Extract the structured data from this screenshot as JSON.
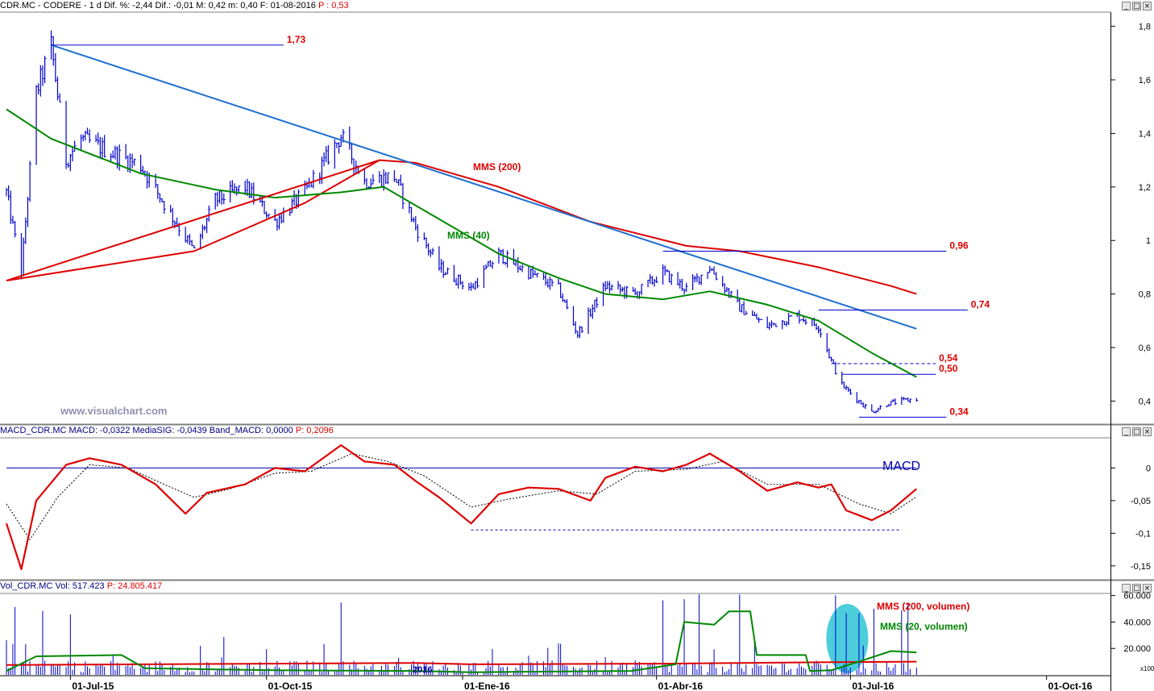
{
  "colors": {
    "price_bars": "#0000cc",
    "mms200": "#dd0000",
    "mms40": "#008800",
    "trendline_down": "#1f6fd0",
    "trendline_up": "#dd0000",
    "macd_line": "#dd0000",
    "macd_signal": "#000000",
    "macd_zero": "#0000aa",
    "annotation_red": "#dd0000",
    "annotation_green": "#008800",
    "highlight": "#2ec4d6",
    "watermark": "#9090b0"
  },
  "price_panel": {
    "header": {
      "symbol": "CDR.MC - CODERE - 1 d",
      "stats": "Dif. %: -2,44  Dif.: -0,01  M: 0,42  m: 0,40  F: 01-08-2016",
      "last": "P : 0,53"
    },
    "watermark": "www.visualchart.com",
    "mms200_label": "MMS (200)",
    "mms40_label": "MMS (40)"
  },
  "macd_panel": {
    "header": {
      "stats": "MACD_CDR.MC MACD: -0,0322  MediaSIG: -0,0439  Band_MACD: 0,0000",
      "last": "P: 0,2096"
    },
    "label": "MACD"
  },
  "volume_panel": {
    "header": {
      "stats": "Vol_CDR.MC Vol: 517.423",
      "last": "P: 24.805.417"
    },
    "mms200_label": "MMS (200, volumen)",
    "mms20_label": "MMS (20, volumen)",
    "year_marker": "2016",
    "scale_note": "x100"
  },
  "x_axis_labels": [
    "01-Jul-15",
    "01-Oct-15",
    "01-Ene-16",
    "01-Abr-16",
    "01-Jul-16",
    "01-Oct-16"
  ],
  "chart_data": [
    {
      "type": "bar",
      "subtype": "ohlc",
      "title": "CDR.MC - CODERE - 1 d",
      "y_axis": {
        "ticks": [
          "0,4",
          "0,6",
          "0,8",
          "1",
          "1,2",
          "1,4",
          "1,6",
          "1,8"
        ],
        "range": [
          0.32,
          1.85
        ]
      },
      "x_axis": {
        "start": "2015-06-01",
        "end": "2016-10-31"
      },
      "price_path": [
        [
          "2015-06-01",
          1.18
        ],
        [
          "2015-06-08",
          0.88
        ],
        [
          "2015-06-15",
          1.55
        ],
        [
          "2015-06-22",
          1.73
        ],
        [
          "2015-06-29",
          1.3
        ],
        [
          "2015-07-06",
          1.38
        ],
        [
          "2015-07-20",
          1.33
        ],
        [
          "2015-08-03",
          1.28
        ],
        [
          "2015-08-17",
          1.1
        ],
        [
          "2015-08-28",
          0.96
        ],
        [
          "2015-09-07",
          1.15
        ],
        [
          "2015-09-21",
          1.2
        ],
        [
          "2015-10-05",
          1.07
        ],
        [
          "2015-10-19",
          1.18
        ],
        [
          "2015-11-05",
          1.39
        ],
        [
          "2015-11-16",
          1.22
        ],
        [
          "2015-11-30",
          1.24
        ],
        [
          "2015-12-10",
          1.05
        ],
        [
          "2015-12-21",
          0.9
        ],
        [
          "2016-01-05",
          0.82
        ],
        [
          "2016-01-18",
          0.95
        ],
        [
          "2016-02-01",
          0.88
        ],
        [
          "2016-02-15",
          0.82
        ],
        [
          "2016-02-24",
          0.65
        ],
        [
          "2016-03-08",
          0.83
        ],
        [
          "2016-03-22",
          0.8
        ],
        [
          "2016-04-04",
          0.88
        ],
        [
          "2016-04-15",
          0.82
        ],
        [
          "2016-04-26",
          0.9
        ],
        [
          "2016-05-10",
          0.75
        ],
        [
          "2016-05-23",
          0.68
        ],
        [
          "2016-06-06",
          0.72
        ],
        [
          "2016-06-16",
          0.68
        ],
        [
          "2016-06-22",
          0.55
        ],
        [
          "2016-06-27",
          0.46
        ],
        [
          "2016-07-05",
          0.4
        ],
        [
          "2016-07-11",
          0.36
        ],
        [
          "2016-07-18",
          0.39
        ],
        [
          "2016-08-01",
          0.41
        ]
      ],
      "series": [
        {
          "name": "MMS (200)",
          "values": [
            [
              "2015-06-01",
              0.85
            ],
            [
              "2015-08-28",
              0.96
            ],
            [
              "2015-10-19",
              1.14
            ],
            [
              "2015-11-23",
              1.3
            ],
            [
              "2015-12-10",
              1.29
            ],
            [
              "2016-01-18",
              1.2
            ],
            [
              "2016-03-01",
              1.07
            ],
            [
              "2016-04-15",
              0.98
            ],
            [
              "2016-05-10",
              0.96
            ],
            [
              "2016-06-16",
              0.9
            ],
            [
              "2016-07-20",
              0.83
            ],
            [
              "2016-08-01",
              0.8
            ]
          ]
        },
        {
          "name": "MMS (40)",
          "values": [
            [
              "2015-06-01",
              1.49
            ],
            [
              "2015-06-22",
              1.38
            ],
            [
              "2015-08-03",
              1.25
            ],
            [
              "2015-09-07",
              1.19
            ],
            [
              "2015-10-05",
              1.16
            ],
            [
              "2015-11-05",
              1.18
            ],
            [
              "2015-11-25",
              1.2
            ],
            [
              "2015-12-21",
              1.08
            ],
            [
              "2016-01-18",
              0.95
            ],
            [
              "2016-02-15",
              0.86
            ],
            [
              "2016-03-08",
              0.8
            ],
            [
              "2016-04-04",
              0.78
            ],
            [
              "2016-04-26",
              0.81
            ],
            [
              "2016-05-23",
              0.76
            ],
            [
              "2016-06-16",
              0.7
            ],
            [
              "2016-07-11",
              0.58
            ],
            [
              "2016-08-01",
              0.49
            ]
          ]
        }
      ],
      "trendlines": [
        {
          "from": [
            "2015-06-22",
            1.73
          ],
          "to": [
            "2016-08-01",
            0.67
          ]
        },
        {
          "from": [
            "2015-06-01",
            0.85
          ],
          "to": [
            "2015-11-23",
            1.3
          ]
        }
      ],
      "levels": [
        {
          "label": "1,73",
          "value": 1.73,
          "from": "2015-06-22",
          "to": "2015-10-09"
        },
        {
          "label": "0,96",
          "value": 0.96,
          "from": "2016-04-04",
          "to": "2016-08-15"
        },
        {
          "label": "0,74",
          "value": 0.74,
          "from": "2016-06-16",
          "to": "2016-08-25"
        },
        {
          "label": "0,54",
          "value": 0.54,
          "from": "2016-06-22",
          "to": "2016-08-10",
          "dashed": true
        },
        {
          "label": "0,50",
          "value": 0.5,
          "from": "2016-06-27",
          "to": "2016-08-10"
        },
        {
          "label": "0,34",
          "value": 0.34,
          "from": "2016-07-05",
          "to": "2016-08-15"
        }
      ]
    },
    {
      "type": "line",
      "title": "MACD_CDR.MC",
      "y_axis": {
        "ticks": [
          "0",
          "-0,05",
          "-0,1",
          "-0,15"
        ],
        "range": [
          -0.17,
          0.045
        ]
      },
      "series": [
        {
          "name": "MACD",
          "values": [
            [
              "2015-06-01",
              -0.085
            ],
            [
              "2015-06-08",
              -0.155
            ],
            [
              "2015-06-15",
              -0.05
            ],
            [
              "2015-06-29",
              0.005
            ],
            [
              "2015-07-10",
              0.015
            ],
            [
              "2015-07-25",
              0.005
            ],
            [
              "2015-08-10",
              -0.025
            ],
            [
              "2015-08-24",
              -0.07
            ],
            [
              "2015-09-03",
              -0.038
            ],
            [
              "2015-09-21",
              -0.025
            ],
            [
              "2015-10-05",
              0.0
            ],
            [
              "2015-10-19",
              -0.005
            ],
            [
              "2015-11-05",
              0.035
            ],
            [
              "2015-11-16",
              0.01
            ],
            [
              "2015-11-30",
              0.005
            ],
            [
              "2015-12-10",
              -0.02
            ],
            [
              "2015-12-21",
              -0.045
            ],
            [
              "2016-01-05",
              -0.085
            ],
            [
              "2016-01-18",
              -0.04
            ],
            [
              "2016-02-01",
              -0.03
            ],
            [
              "2016-02-15",
              -0.032
            ],
            [
              "2016-03-01",
              -0.05
            ],
            [
              "2016-03-08",
              -0.015
            ],
            [
              "2016-03-22",
              0.002
            ],
            [
              "2016-04-04",
              -0.005
            ],
            [
              "2016-04-15",
              0.005
            ],
            [
              "2016-04-26",
              0.022
            ],
            [
              "2016-05-10",
              -0.005
            ],
            [
              "2016-05-23",
              -0.035
            ],
            [
              "2016-06-06",
              -0.022
            ],
            [
              "2016-06-16",
              -0.03
            ],
            [
              "2016-06-22",
              -0.025
            ],
            [
              "2016-06-29",
              -0.065
            ],
            [
              "2016-07-11",
              -0.08
            ],
            [
              "2016-07-20",
              -0.065
            ],
            [
              "2016-08-01",
              -0.032
            ]
          ]
        },
        {
          "name": "MediaSIG",
          "values": [
            [
              "2015-06-01",
              -0.055
            ],
            [
              "2015-06-12",
              -0.11
            ],
            [
              "2015-06-25",
              -0.045
            ],
            [
              "2015-07-10",
              0.005
            ],
            [
              "2015-07-28",
              0.0
            ],
            [
              "2015-08-14",
              -0.025
            ],
            [
              "2015-08-28",
              -0.045
            ],
            [
              "2015-09-14",
              -0.032
            ],
            [
              "2015-10-05",
              -0.008
            ],
            [
              "2015-10-22",
              -0.005
            ],
            [
              "2015-11-10",
              0.022
            ],
            [
              "2015-11-27",
              0.01
            ],
            [
              "2015-12-14",
              -0.012
            ],
            [
              "2016-01-05",
              -0.06
            ],
            [
              "2016-01-22",
              -0.048
            ],
            [
              "2016-02-15",
              -0.035
            ],
            [
              "2016-03-04",
              -0.04
            ],
            [
              "2016-03-22",
              -0.005
            ],
            [
              "2016-04-15",
              -0.002
            ],
            [
              "2016-05-02",
              0.01
            ],
            [
              "2016-05-23",
              -0.025
            ],
            [
              "2016-06-16",
              -0.025
            ],
            [
              "2016-07-05",
              -0.055
            ],
            [
              "2016-07-20",
              -0.07
            ],
            [
              "2016-08-01",
              -0.044
            ]
          ]
        }
      ],
      "levels": [
        {
          "value": 0,
          "from": "2015-06-01",
          "to": "2016-08-01"
        },
        {
          "value": -0.095,
          "from": "2016-01-05",
          "to": "2016-07-25",
          "dashed": true
        }
      ]
    },
    {
      "type": "bar",
      "title": "Vol_CDR.MC",
      "y_axis": {
        "ticks": [
          "20.000",
          "40.000",
          "60.000"
        ],
        "range": [
          0,
          61000
        ]
      },
      "series": [
        {
          "name": "MMS (200, volumen)",
          "values": [
            [
              "2015-06-01",
              7500
            ],
            [
              "2015-12-10",
              9000
            ],
            [
              "2016-01-05",
              8000
            ],
            [
              "2016-04-04",
              8500
            ],
            [
              "2016-06-16",
              9500
            ],
            [
              "2016-08-01",
              10000
            ]
          ]
        },
        {
          "name": "MMS (20, volumen)",
          "values": [
            [
              "2015-06-01",
              3000
            ],
            [
              "2015-06-15",
              14000
            ],
            [
              "2015-07-25",
              15000
            ],
            [
              "2015-08-05",
              5000
            ],
            [
              "2015-10-05",
              3500
            ],
            [
              "2015-12-10",
              3000
            ],
            [
              "2016-01-05",
              2000
            ],
            [
              "2016-03-20",
              3000
            ],
            [
              "2016-04-10",
              8000
            ],
            [
              "2016-04-14",
              40000
            ],
            [
              "2016-04-28",
              38000
            ],
            [
              "2016-05-05",
              48000
            ],
            [
              "2016-05-15",
              48000
            ],
            [
              "2016-05-18",
              15000
            ],
            [
              "2016-06-10",
              15000
            ],
            [
              "2016-06-12",
              3000
            ],
            [
              "2016-06-22",
              3500
            ],
            [
              "2016-07-05",
              10000
            ],
            [
              "2016-07-20",
              18000
            ],
            [
              "2016-08-01",
              17000
            ]
          ]
        }
      ]
    }
  ]
}
